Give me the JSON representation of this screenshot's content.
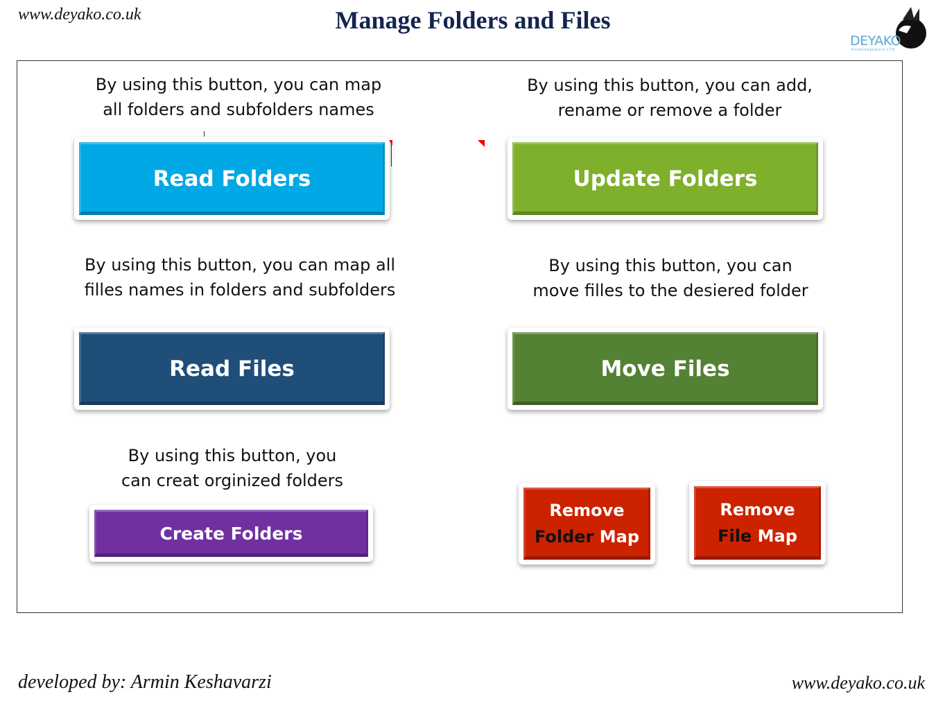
{
  "header": {
    "site_url": "www.deyako.co.uk",
    "title": "Manage Folders and Files",
    "logo": {
      "name": "DEYAKO",
      "tagline": "Knowledgeware LTD",
      "icon": "winged-panther-logo-icon"
    }
  },
  "sections": {
    "read_folders": {
      "description_line1": "By using this button, you can map",
      "description_line2": "all folders and subfolders names",
      "button_label": "Read Folders",
      "color": "#00a8e6"
    },
    "update_folders": {
      "description_line1": "By using this button, you can add,",
      "description_line2": "rename or remove a folder",
      "button_label": "Update Folders",
      "color": "#7fb02b"
    },
    "read_files": {
      "description_line1": "By using this button, you can map all",
      "description_line2": "filles names in folders and subfolders",
      "button_label": "Read Files",
      "color": "#1f4e79"
    },
    "move_files": {
      "description_line1": "By using this button, you can",
      "description_line2": "move filles to the desiered folder",
      "button_label": "Move Files",
      "color": "#548235"
    },
    "create_folders": {
      "description_line1": "By using this button, you",
      "description_line2": "can creat orginized folders",
      "button_label": "Create Folders",
      "color": "#7030a0"
    },
    "remove_folder_map": {
      "label_line1": "Remove",
      "label_word_dark": "Folder",
      "label_word_light": "Map",
      "color": "#cc2200"
    },
    "remove_file_map": {
      "label_line1": "Remove",
      "label_word_dark": "File",
      "label_word_light": "Map",
      "color": "#cc2200"
    }
  },
  "footer": {
    "developer": "developed by: Armin Keshavarzi",
    "site_url": "www.deyako.co.uk"
  }
}
